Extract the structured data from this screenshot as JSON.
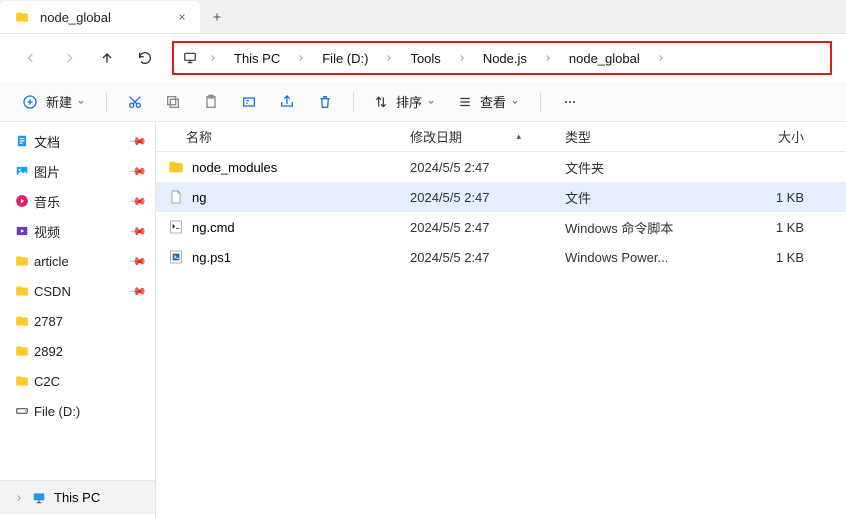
{
  "tab": {
    "title": "node_global"
  },
  "breadcrumb": {
    "items": [
      {
        "label": "This PC"
      },
      {
        "label": "File (D:)"
      },
      {
        "label": "Tools"
      },
      {
        "label": "Node.js"
      },
      {
        "label": "node_global"
      }
    ]
  },
  "toolbar": {
    "new_label": "新建",
    "sort_label": "排序",
    "view_label": "查看"
  },
  "sidebar": {
    "items": [
      {
        "label": "文档",
        "icon": "doc",
        "pinned": true,
        "color": "#2196f3"
      },
      {
        "label": "图片",
        "icon": "img",
        "pinned": true,
        "color": "#03a9f4"
      },
      {
        "label": "音乐",
        "icon": "music",
        "pinned": true,
        "color": "#e91e63"
      },
      {
        "label": "视频",
        "icon": "video",
        "pinned": true,
        "color": "#673ab7"
      },
      {
        "label": "article",
        "icon": "folder",
        "pinned": true,
        "color": "#ffca28"
      },
      {
        "label": "CSDN",
        "icon": "folder",
        "pinned": true,
        "color": "#ffca28"
      },
      {
        "label": "2787",
        "icon": "folder",
        "pinned": false,
        "color": "#ffca28"
      },
      {
        "label": "2892",
        "icon": "folder",
        "pinned": false,
        "color": "#ffca28"
      },
      {
        "label": "C2C",
        "icon": "folder",
        "pinned": false,
        "color": "#ffca28"
      },
      {
        "label": "File (D:)",
        "icon": "drive",
        "pinned": false,
        "color": "#555"
      }
    ],
    "bottom_label": "This PC"
  },
  "columns": {
    "name": "名称",
    "date": "修改日期",
    "type": "类型",
    "size": "大小"
  },
  "files": [
    {
      "name": "node_modules",
      "date": "2024/5/5 2:47",
      "type": "文件夹",
      "size": "",
      "icon": "folder",
      "selected": false
    },
    {
      "name": "ng",
      "date": "2024/5/5 2:47",
      "type": "文件",
      "size": "1 KB",
      "icon": "file",
      "selected": true
    },
    {
      "name": "ng.cmd",
      "date": "2024/5/5 2:47",
      "type": "Windows 命令脚本",
      "size": "1 KB",
      "icon": "cmd",
      "selected": false
    },
    {
      "name": "ng.ps1",
      "date": "2024/5/5 2:47",
      "type": "Windows Power...",
      "size": "1 KB",
      "icon": "ps1",
      "selected": false
    }
  ]
}
